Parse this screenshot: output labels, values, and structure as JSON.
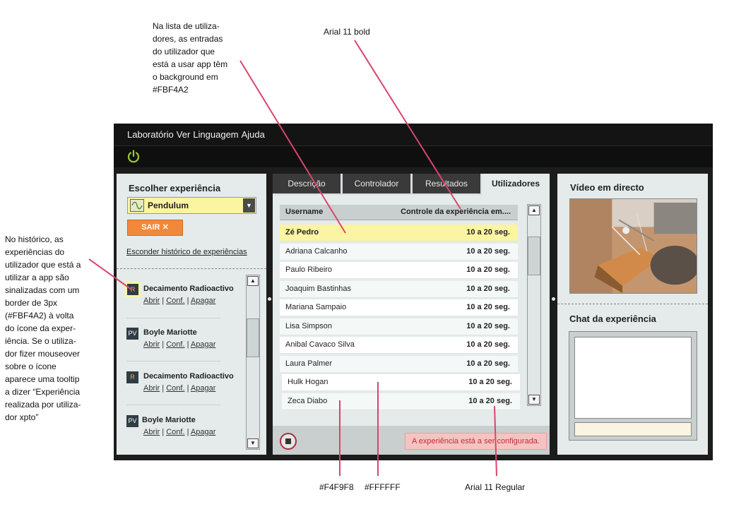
{
  "annotations": {
    "user_list_note": "Na lista de utiliza-\ndores, as entradas\ndo utilizador que\nestá a usar app têm\no background em\n#FBF4A2",
    "font_bold_note": "Arial 11 bold",
    "history_note": "No histórico, as\nexperiências do\nutilizador que está a\nutilizar a app são\nsinalizadas com um\nborder de 3px\n(#FBF4A2) à volta\ndo ícone da exper-\niência. Se o utiliza-\ndor fizer mouseover\nsobre o ícone\naparece uma tooltip\na dizer “Experiência\nrealizada por utiliza-\ndor xpto”",
    "color_alt_note": "#F4F9F8",
    "color_white_note": "#FFFFFF",
    "font_regular_note": "Arial 11 Regular"
  },
  "menu": [
    "Laboratório",
    "Ver",
    "Linguagem",
    "Ajuda"
  ],
  "left": {
    "title": "Escolher experiência",
    "selected_experiment": "Pendulum",
    "exit_label": "SAIR",
    "exit_icon": "✕",
    "hide_history": "Esconder histórico de experiências",
    "history": [
      {
        "icon": "R",
        "name": "Decaimento Radioactivo",
        "active": true
      },
      {
        "icon": "PV",
        "name": "Boyle Mariotte",
        "active": false
      },
      {
        "icon": "R",
        "name": "Decaimento Radioactivo",
        "active": false
      },
      {
        "icon": "PV",
        "name": "Boyle Mariotte",
        "active": false
      }
    ],
    "links": {
      "open": "Abrir",
      "sep": "|",
      "conf": "Conf.",
      "delete": "Apagar"
    }
  },
  "tabs": [
    "Descrição",
    "Controlador",
    "Resultados",
    "Utilizadores"
  ],
  "active_tab": "Utilizadores",
  "users": {
    "header_username": "Username",
    "header_control": "Controle da experiência em....",
    "rows": [
      {
        "name": "Zé Pedro",
        "time": "10 a 20 seg.",
        "active": true,
        "bg": "#FBF4A2"
      },
      {
        "name": "Adriana Calcanho",
        "time": "10 a 20 seg.",
        "bg": "#F4F9F8"
      },
      {
        "name": "Paulo Ribeiro",
        "time": "10 a 20 seg.",
        "bg": "#FFFFFF"
      },
      {
        "name": "Joaquim Bastinhas",
        "time": "10 a 20 seg.",
        "bg": "#F4F9F8"
      },
      {
        "name": "Mariana Sampaio",
        "time": "10 a 20 seg.",
        "bg": "#FFFFFF"
      },
      {
        "name": "Lisa Simpson",
        "time": "10 a 20 seg.",
        "bg": "#F4F9F8"
      },
      {
        "name": "Anibal Cavaco Silva",
        "time": "10 a 20 seg.",
        "bg": "#FFFFFF"
      },
      {
        "name": "Laura Palmer",
        "time": "10 a 20 seg.",
        "bg": "#F4F9F8"
      },
      {
        "name": "Hulk Hogan",
        "time": "10 a 20 seg.",
        "bg": "#FFFFFF"
      },
      {
        "name": "Zeca Diabo",
        "time": "10 a 20 seg.",
        "bg": "#F4F9F8"
      }
    ]
  },
  "status": "A experiência está a ser configurada.",
  "right": {
    "video_title": "Vídeo em directo",
    "chat_title": "Chat da experiência"
  },
  "colors": {
    "highlight": "#FBF4A2",
    "accent_orange": "#F2883A",
    "annotation_line": "#D9466A",
    "power_green": "#9BCB3A"
  }
}
